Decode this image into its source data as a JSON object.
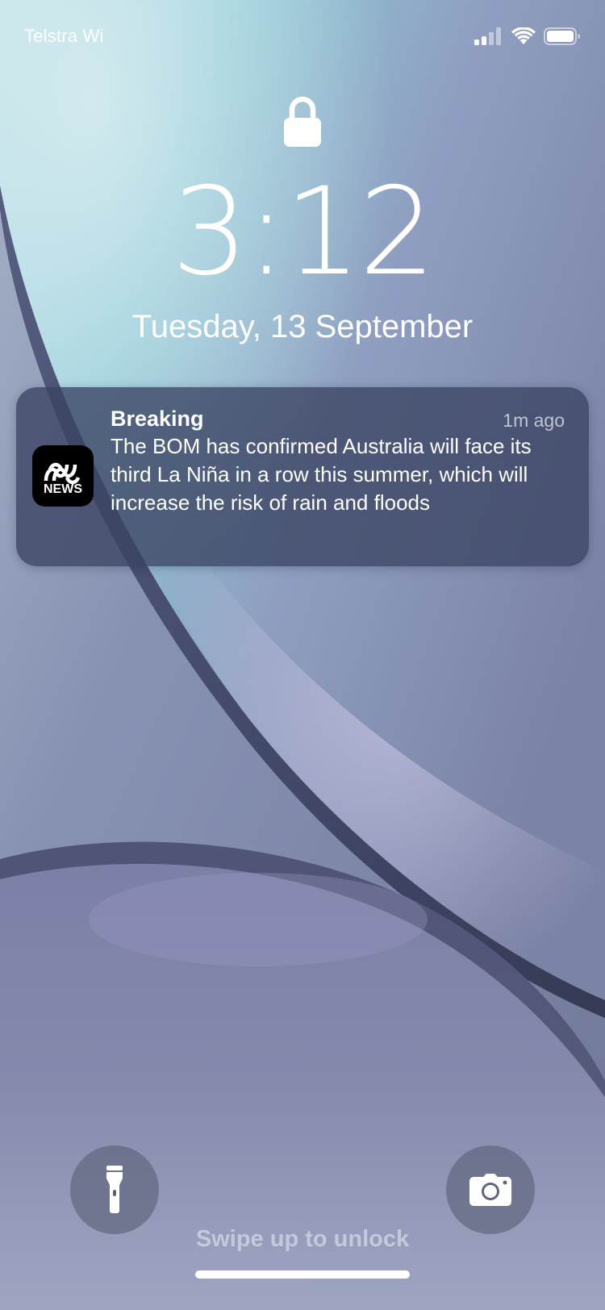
{
  "status_bar": {
    "carrier": "Telstra Wi",
    "icons": [
      "cellular-signal-icon",
      "wifi-icon",
      "battery-icon"
    ]
  },
  "lock_screen": {
    "lock_icon": "lock-icon",
    "time": "3:12",
    "date": "Tuesday, 13 September"
  },
  "notification": {
    "app_icon": "abc-news-app-icon",
    "app_icon_label": "NEWS",
    "title": "Breaking",
    "time": "1m ago",
    "body": "The BOM has confirmed Australia will face its third La Niña in a row this summer, which will increase the risk of rain and floods"
  },
  "controls": {
    "flashlight_icon": "flashlight-icon",
    "camera_icon": "camera-icon",
    "unlock_hint": "Swipe up to unlock"
  },
  "colors": {
    "notification_bg": "#3a4262",
    "app_icon_bg": "#000000"
  }
}
